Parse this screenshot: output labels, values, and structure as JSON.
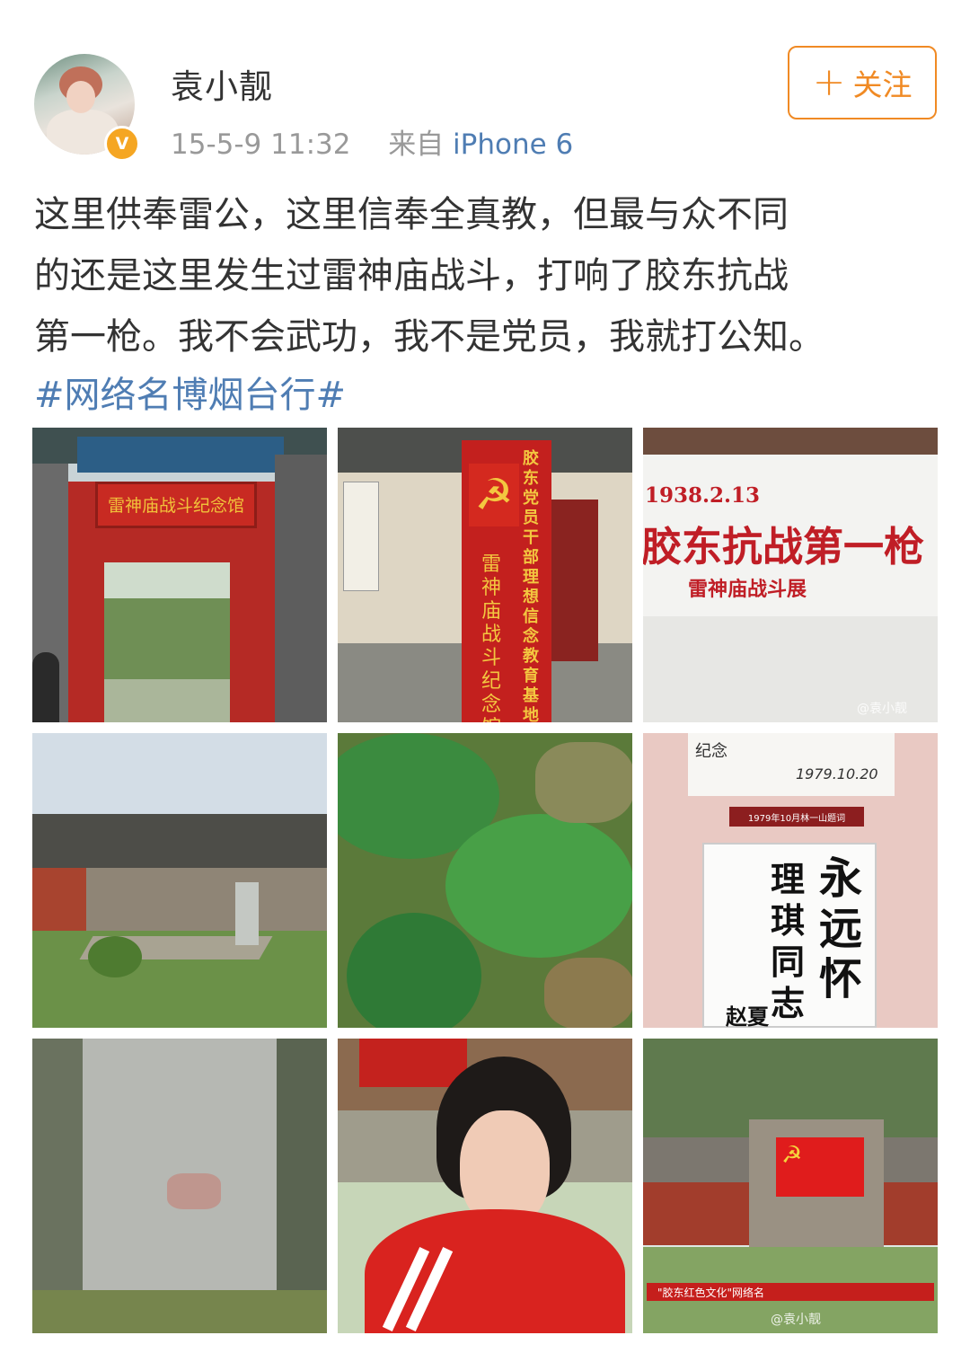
{
  "user": {
    "name": "袁小靓",
    "verified_badge": "V",
    "timestamp": "15-5-9 11:32",
    "source_prefix": "来自",
    "device": "iPhone 6"
  },
  "follow_button": {
    "icon": "plus-icon",
    "label": "关注",
    "color": "#f08a24"
  },
  "post": {
    "lines": [
      "这里供奉雷公，这里信奉全真教，但最与众不同",
      "的还是这里发生过雷神庙战斗，打响了胶东抗战",
      "第一枪。我不会武功，我不是党员，我就打公知。"
    ],
    "hashtag": "#网络名博烟台行#"
  },
  "images": [
    {
      "alt": "memorial gate",
      "text": "雷神庙战斗纪念馆"
    },
    {
      "alt": "red party sign",
      "text_vertical_1": "胶东党员干部理想信念教育基地",
      "text_vertical_2": "雷神庙战斗纪念馆"
    },
    {
      "alt": "white wall exhibit",
      "date": "1938.2.13",
      "headline": "胶东抗战第一枪",
      "sub": "雷神庙战斗展",
      "watermark": "@袁小靓"
    },
    {
      "alt": "temple courtyard"
    },
    {
      "alt": "clover patch"
    },
    {
      "alt": "calligraphy display",
      "top_note": "纪念",
      "signature": "1979.10.20",
      "caption": "1979年10月林一山题词",
      "calligraphy_col1": "永远怀",
      "calligraphy_col2": "理琪同志",
      "small": "赵夏"
    },
    {
      "alt": "stone stele"
    },
    {
      "alt": "selfie"
    },
    {
      "alt": "red flag wall",
      "banner": "\"胶东红色文化\"网络名",
      "watermark": "@袁小靓"
    }
  ],
  "colors": {
    "link": "#4f7db3",
    "accent": "#f08a24",
    "text": "#333333",
    "meta": "#999999"
  }
}
